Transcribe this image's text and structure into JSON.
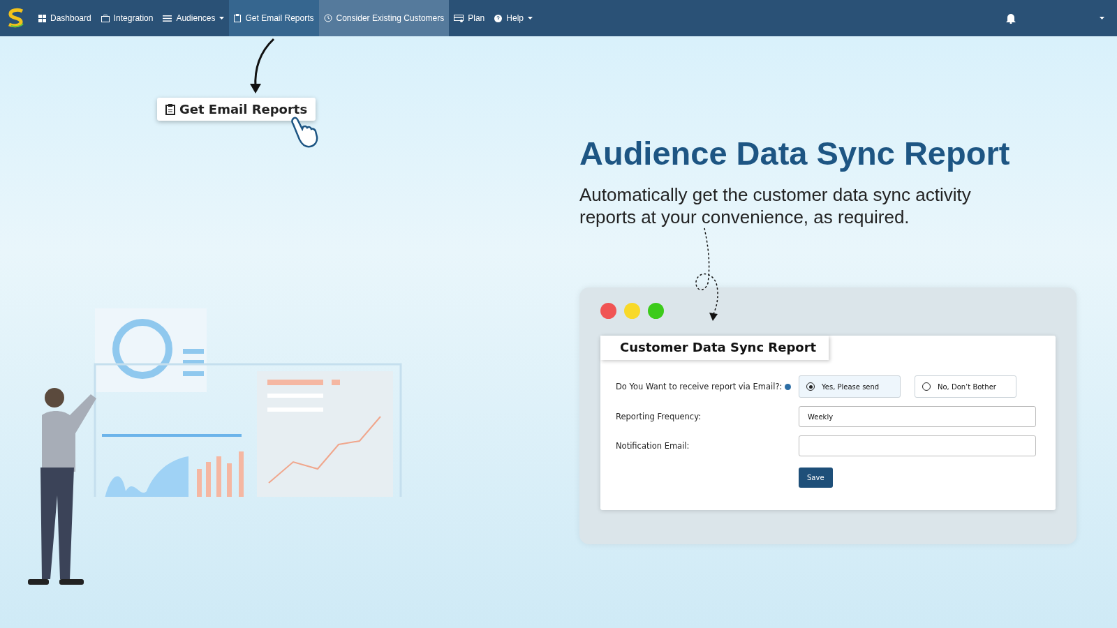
{
  "nav": {
    "items": [
      {
        "label": "Dashboard",
        "selected": false,
        "hovered": false,
        "dropdown": false
      },
      {
        "label": "Integration",
        "selected": false,
        "hovered": false,
        "dropdown": false
      },
      {
        "label": "Audiences",
        "selected": false,
        "hovered": false,
        "dropdown": true
      },
      {
        "label": "Get Email Reports",
        "selected": true,
        "hovered": false,
        "dropdown": false
      },
      {
        "label": "Consider Existing Customers",
        "selected": false,
        "hovered": true,
        "dropdown": false
      },
      {
        "label": "Plan",
        "selected": false,
        "hovered": false,
        "dropdown": false
      },
      {
        "label": "Help",
        "selected": false,
        "hovered": false,
        "dropdown": true
      }
    ]
  },
  "callout": {
    "label": "Get Email Reports"
  },
  "hero": {
    "title": "Audience Data Sync Report",
    "subtitle": "Automatically get the customer data sync activity reports at your convenience, as required."
  },
  "report": {
    "title": "Customer Data Sync Report",
    "fields": [
      {
        "kind": "radio",
        "label": "Do You Want to receive report via Email?:",
        "options": [
          {
            "label": "Yes, Please send",
            "selected": true
          },
          {
            "label": "No, Don’t Bother",
            "selected": false
          }
        ]
      },
      {
        "kind": "text",
        "label": "Reporting Frequency:",
        "value": "Weekly"
      },
      {
        "kind": "text",
        "label": "Notification Email:"
      }
    ],
    "save": "Save"
  }
}
